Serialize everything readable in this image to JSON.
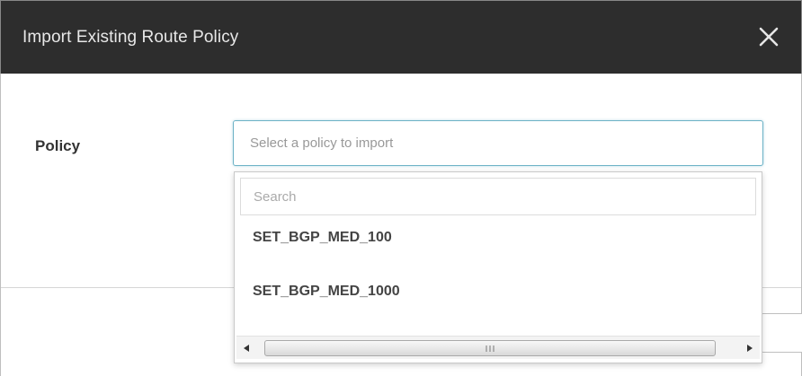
{
  "dialog": {
    "title": "Import Existing Route Policy",
    "close_icon": "close-icon"
  },
  "form": {
    "policy_label": "Policy",
    "policy_placeholder": "Select a policy to import"
  },
  "dropdown": {
    "search_placeholder": "Search",
    "options": [
      {
        "label": "SET_BGP_MED_100"
      },
      {
        "label": "SET_BGP_MED_1000"
      }
    ]
  },
  "colors": {
    "titlebar_bg": "#2d2d2d",
    "focus_border": "#6cb2c6"
  }
}
